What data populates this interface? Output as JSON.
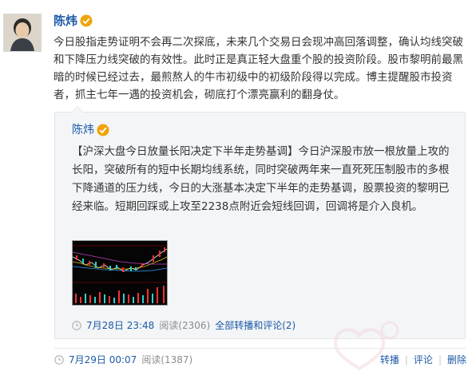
{
  "post": {
    "author": "陈炜",
    "text": "今日股指走势证明不会再二次探底，未来几个交易日会现冲高回落调整，确认均线突破和下降压力线突破的有效性。此时正是真正轻大盘重个股的投资阶段。股市黎明前最黑暗的时候已经过去，最煎熬人的牛市初级中的初级阶段得以完成。博主提醒股市投资者，抓主七年一遇的投资机会，砌底打个漂亮赢利的翻身仗。",
    "time": "7月29日 00:07",
    "reads": "阅读(1387)",
    "actions": [
      "转播",
      "评论",
      "删除"
    ]
  },
  "repost": {
    "author": "陈炜",
    "text": "【沪深大盘今日放量长阳决定下半年走势基调】今日沪深股市放一根放量上攻的长阳，突破所有的短中长期均线系统，同时突破两年来一直死死压制股市的多根下降通道的压力线，今日的大涨基本决定下半年的走势基调，股票投资的黎明已经来临。短期回踩或上攻至2238点附近会短线回调，回调将是介入良机。",
    "time": "7月28日 23:48",
    "reads": "阅读(2306)",
    "all_link": "全部转播和评论",
    "count": "(2)"
  },
  "colors": {
    "link": "#1c5aa6",
    "meta": "#8c8c8c",
    "repost_bg": "#f3f5f7",
    "badge": "#f0a30a"
  },
  "icons": [
    "avatar",
    "verified-badge-icon",
    "clock-icon",
    "stock-chart-thumbnail",
    "watermark-logo"
  ]
}
